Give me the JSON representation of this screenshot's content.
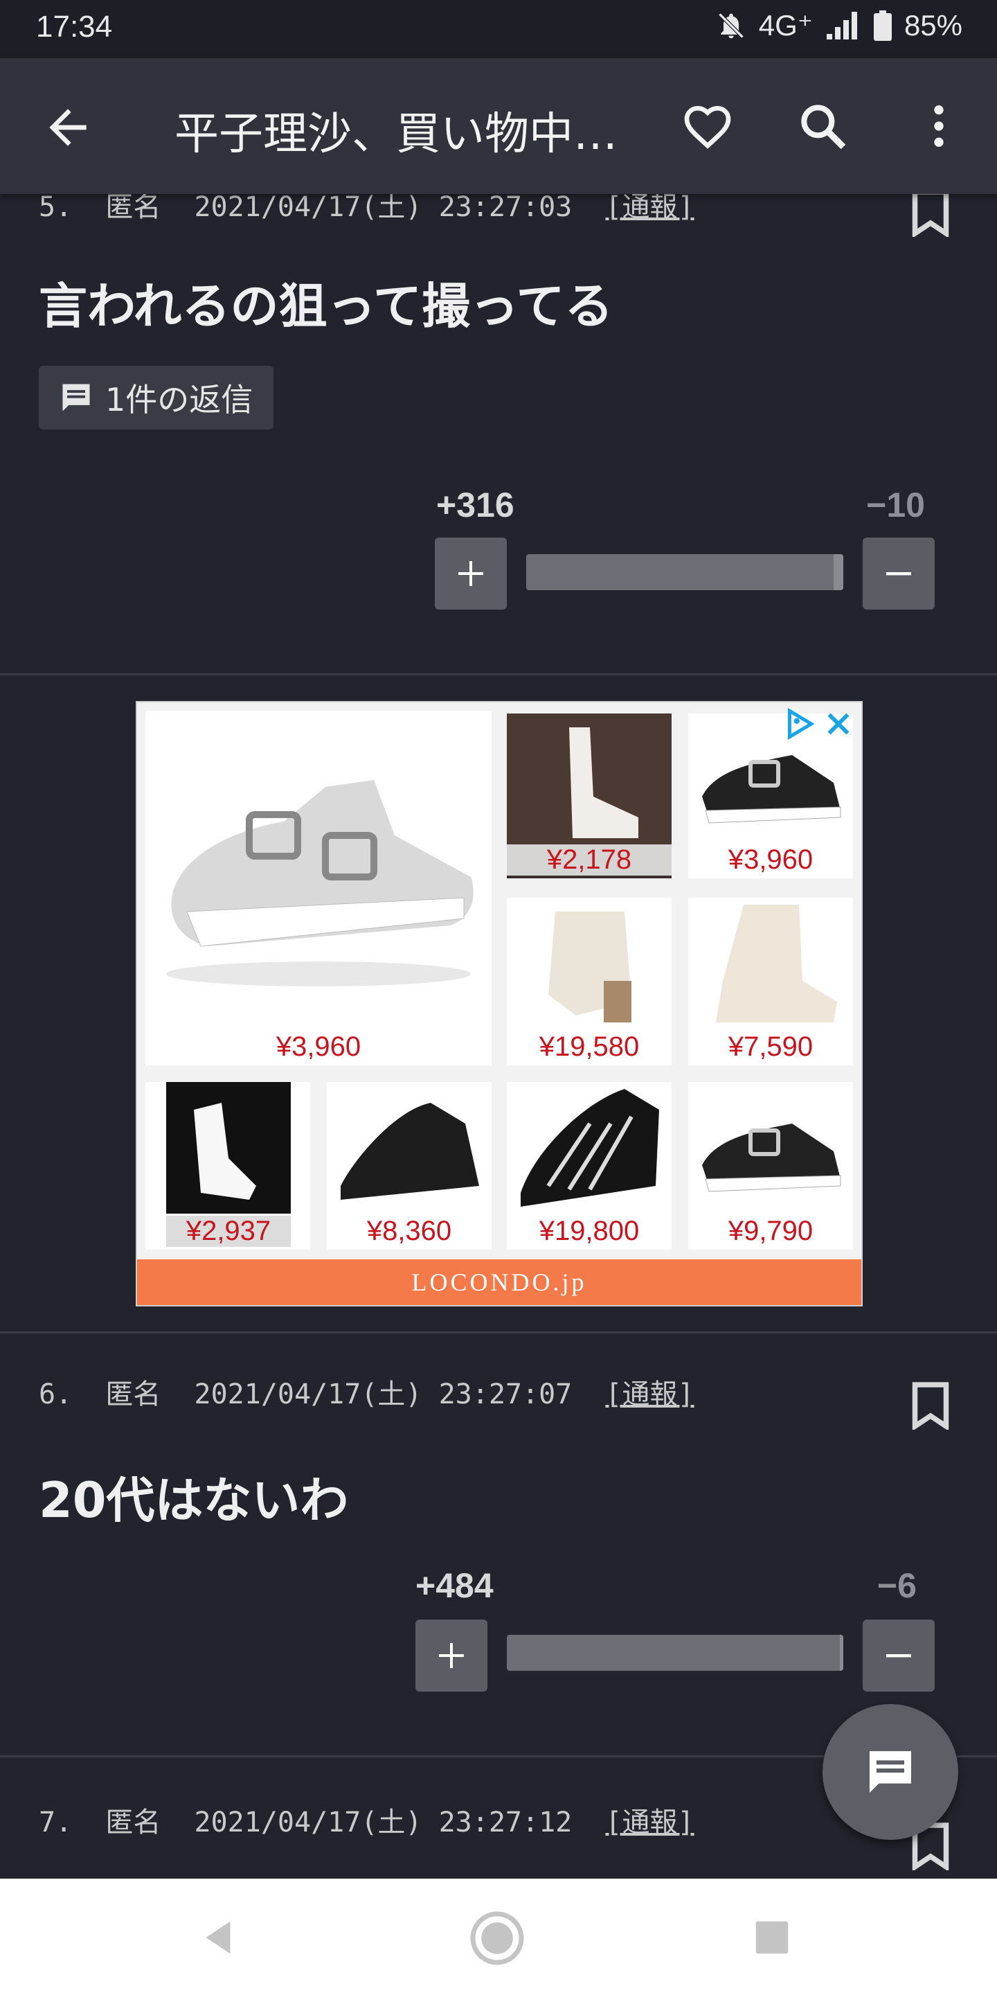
{
  "status": {
    "time": "17:34",
    "network": "4G⁺",
    "battery": "85%"
  },
  "appbar": {
    "title": "平子理沙、買い物中…"
  },
  "comments": [
    {
      "number": "5.",
      "author": "匿名",
      "datetime": "2021/04/17(土) 23:27:03",
      "report": "[通報]",
      "text": "言われるの狙って撮ってる",
      "reply_label": "1件の返信",
      "plus": "+316",
      "minus": "−10",
      "plus_ratio": 0.97
    },
    {
      "number": "6.",
      "author": "匿名",
      "datetime": "2021/04/17(土) 23:27:07",
      "report": "[通報]",
      "text": "20代はないわ",
      "plus": "+484",
      "minus": "−6",
      "plus_ratio": 0.99
    },
    {
      "number": "7.",
      "author": "匿名",
      "datetime": "2021/04/17(土) 23:27:12",
      "report": "[通報]"
    }
  ],
  "ad": {
    "brand": "LOCONDO.jp",
    "prices": [
      "¥3,960",
      "¥2,178",
      "¥3,960",
      "¥19,580",
      "¥7,590",
      "¥2,937",
      "¥8,360",
      "¥19,800",
      "¥9,790"
    ]
  },
  "colors": {
    "background": "#22232c",
    "appbar": "#31323b",
    "price": "#c8141e",
    "ad_brand": "#f47a4a"
  },
  "icons": [
    "back-arrow-icon",
    "heart-icon",
    "search-icon",
    "more-vert-icon",
    "bookmark-icon",
    "comment-icon",
    "plus-icon",
    "minus-icon",
    "adchoices-icon",
    "close-icon",
    "chat-icon",
    "nav-back-icon",
    "nav-home-icon",
    "nav-recents-icon"
  ]
}
